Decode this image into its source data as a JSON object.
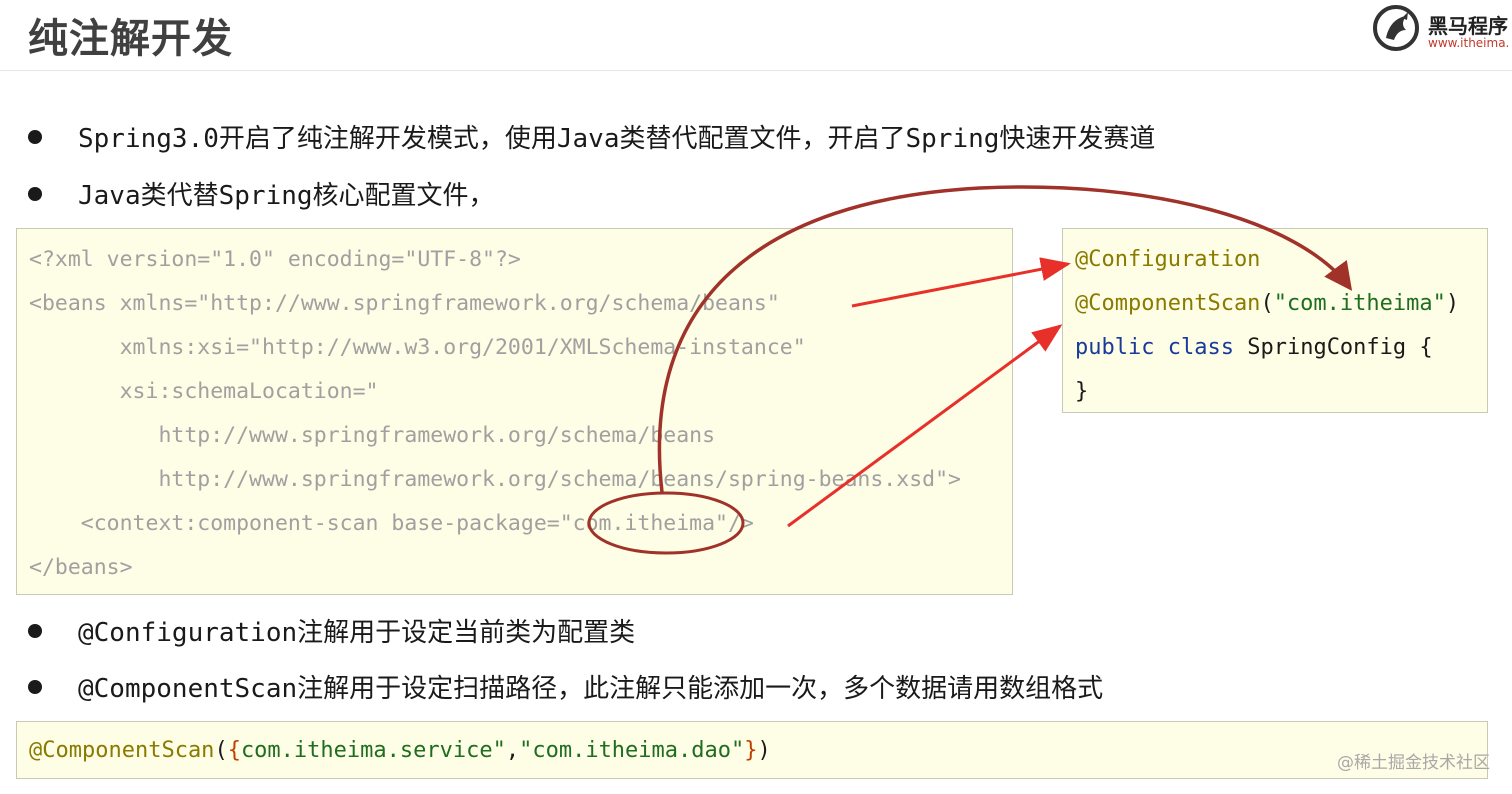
{
  "header": {
    "title": "纯注解开发",
    "logo": {
      "name": "黑马程序",
      "url": "www.itheima."
    }
  },
  "bullets": [
    "Spring3.0开启了纯注解开发模式，使用Java类替代配置文件，开启了Spring快速开发赛道",
    "Java类代替Spring核心配置文件，",
    "@Configuration注解用于设定当前类为配置类",
    "@ComponentScan注解用于设定扫描路径，此注解只能添加一次，多个数据请用数组格式"
  ],
  "xml_code": {
    "lines": [
      "<?xml version=\"1.0\" encoding=\"UTF-8\"?>",
      "<beans xmlns=\"http://www.springframework.org/schema/beans\"",
      "       xmlns:xsi=\"http://www.w3.org/2001/XMLSchema-instance\"",
      "       xsi:schemaLocation=\"",
      "          http://www.springframework.org/schema/beans",
      "          http://www.springframework.org/schema/beans/spring-beans.xsd\">",
      "    <context:component-scan base-package=\"com.itheima\"/>",
      "</beans>"
    ]
  },
  "config_code": {
    "annotation1": "@Configuration",
    "annotation2": "@ComponentScan",
    "paren_open": "(",
    "package_string": "\"com.itheima\"",
    "paren_close": ")",
    "keyword_public": "public",
    "keyword_class": "class",
    "class_name": "SpringConfig {",
    "closing_brace": "}"
  },
  "scan_code": {
    "annotation": "@ComponentScan",
    "paren_open": "(",
    "brace_open": "{",
    "string1": "com.itheima.service\"",
    "comma": ",",
    "string2": "\"com.itheima.dao\"",
    "brace_close": "}",
    "paren_close": ")"
  },
  "watermark": "@稀土掘金技术社区",
  "colors": {
    "code_background": "#fefde6",
    "annotation": "#8a7a00",
    "keyword": "#1a3a9a",
    "string": "#1f6e1f",
    "arrow_red": "#e8302a",
    "curve_dark_red": "#a0322a"
  }
}
